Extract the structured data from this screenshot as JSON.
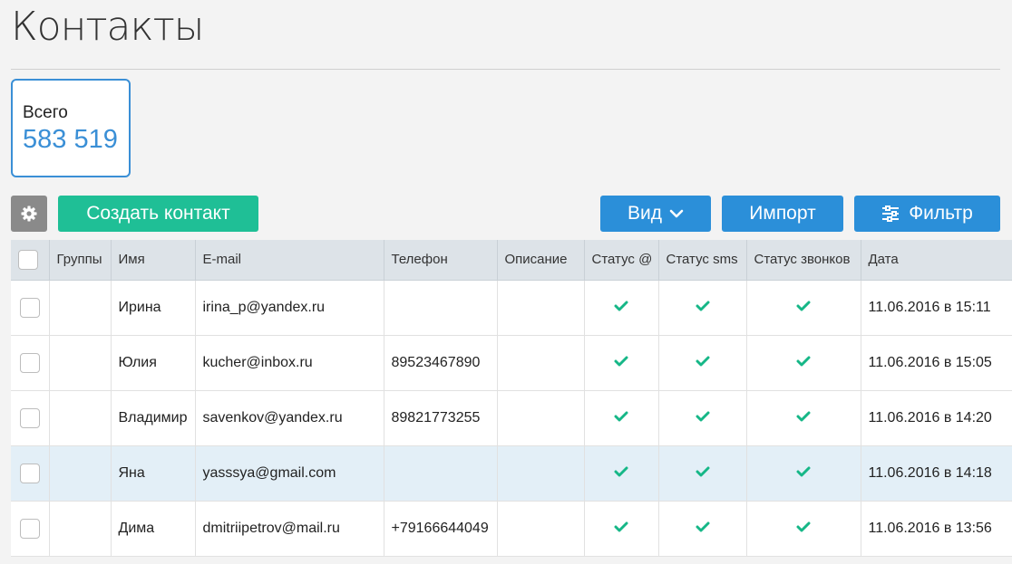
{
  "page": {
    "title": "Контакты"
  },
  "summary": {
    "label": "Всего",
    "value": "583 519"
  },
  "toolbar": {
    "create_label": "Создать контакт",
    "view_label": "Вид",
    "import_label": "Импорт",
    "filter_label": "Фильтр"
  },
  "icons": {
    "settings": "gear-icon",
    "view": "chevron-down-icon",
    "filter": "sliders-icon",
    "status": "check-icon"
  },
  "colors": {
    "accent": "#2b8fd9",
    "create": "#1fbf96",
    "check": "#16b787",
    "selected_row": "#e3eff7"
  },
  "table": {
    "columns": [
      "Группы",
      "Имя",
      "E-mail",
      "Телефон",
      "Описание",
      "Статус @",
      "Статус sms",
      "Статус звонков",
      "Дата"
    ],
    "rows": [
      {
        "group": "",
        "name": "Ирина",
        "email": "irina_p@yandex.ru",
        "phone": "",
        "description": "",
        "status_email": true,
        "status_sms": true,
        "status_calls": true,
        "date": "11.06.2016 в 15:11",
        "highlighted": false
      },
      {
        "group": "",
        "name": "Юлия",
        "email": "kucher@inbox.ru",
        "phone": "89523467890",
        "description": "",
        "status_email": true,
        "status_sms": true,
        "status_calls": true,
        "date": "11.06.2016 в 15:05",
        "highlighted": false
      },
      {
        "group": "",
        "name": "Владимир",
        "email": "savenkov@yandex.ru",
        "phone": "89821773255",
        "description": "",
        "status_email": true,
        "status_sms": true,
        "status_calls": true,
        "date": "11.06.2016 в 14:20",
        "highlighted": false
      },
      {
        "group": "",
        "name": "Яна",
        "email": "yasssya@gmail.com",
        "phone": "",
        "description": "",
        "status_email": true,
        "status_sms": true,
        "status_calls": true,
        "date": "11.06.2016 в 14:18",
        "highlighted": true
      },
      {
        "group": "",
        "name": "Дима",
        "email": "dmitriipetrov@mail.ru",
        "phone": "+79166644049",
        "description": "",
        "status_email": true,
        "status_sms": true,
        "status_calls": true,
        "date": "11.06.2016 в 13:56",
        "highlighted": false
      }
    ]
  }
}
